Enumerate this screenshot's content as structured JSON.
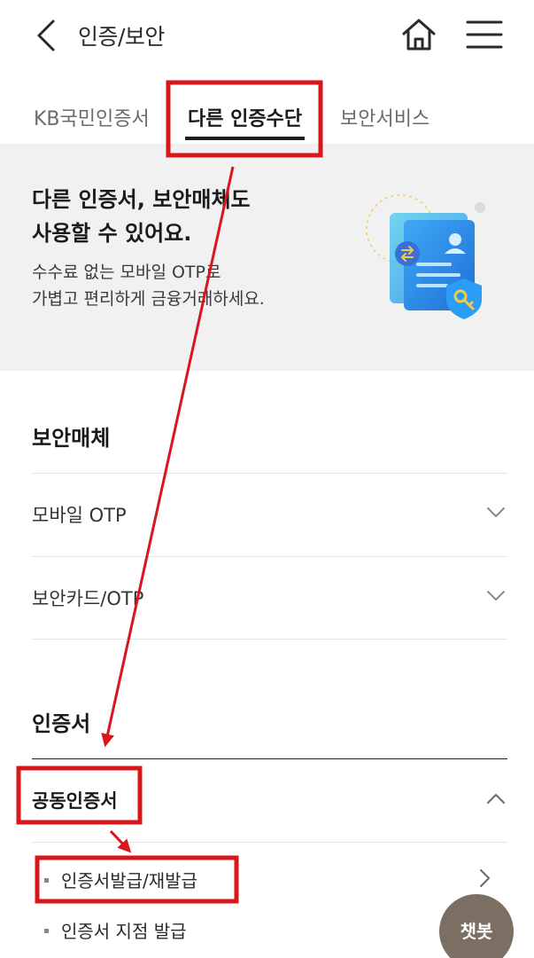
{
  "header": {
    "title": "인증/보안",
    "back_icon": "back-chevron-icon",
    "home_icon": "home-icon",
    "menu_icon": "hamburger-menu-icon"
  },
  "tabs": [
    {
      "label": "KB국민인증서",
      "active": false
    },
    {
      "label": "다른 인증수단",
      "active": true
    },
    {
      "label": "보안서비스",
      "active": false
    }
  ],
  "banner": {
    "title_line1": "다른 인증서, 보안매체도",
    "title_line2": "사용할 수 있어요.",
    "desc_line1": "수수료 없는 모바일 OTP로",
    "desc_line2": "가볍고 편리하게 금융거래하세요."
  },
  "security_media": {
    "title": "보안매체",
    "items": [
      {
        "label": "모바일 OTP",
        "expanded": false
      },
      {
        "label": "보안카드/OTP",
        "expanded": false
      }
    ]
  },
  "certificates": {
    "title": "인증서",
    "group_label": "공동인증서",
    "expanded": true,
    "sub_items": [
      {
        "label": "인증서발급/재발급"
      },
      {
        "label": "인증서 지점 발급"
      }
    ]
  },
  "chatbot": {
    "label": "챗봇"
  },
  "annotation_color": "#d9161c"
}
